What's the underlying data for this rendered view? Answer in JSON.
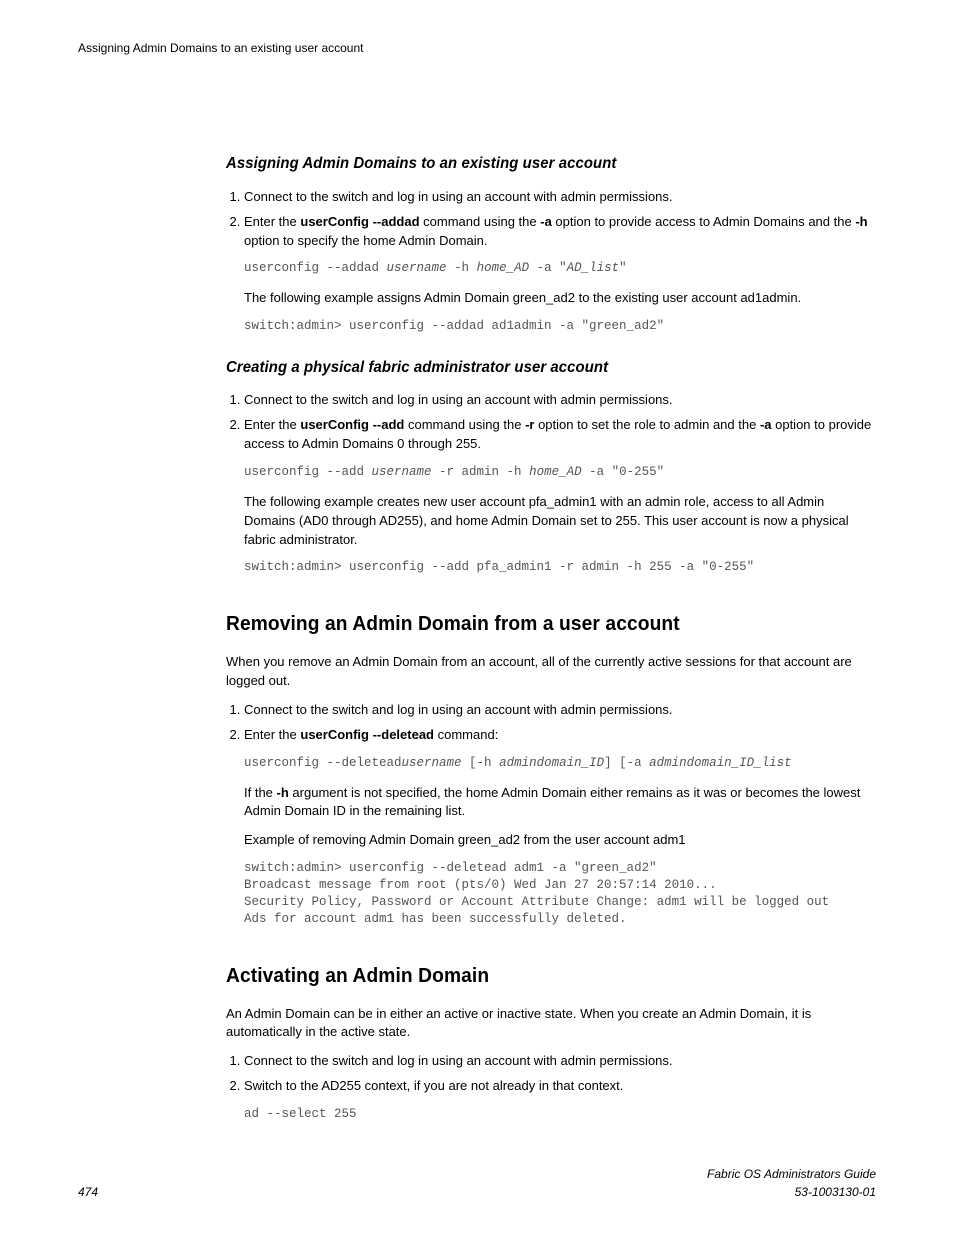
{
  "header": {
    "running": "Assigning Admin Domains to an existing user account"
  },
  "section1": {
    "title": "Assigning Admin Domains to an existing user account",
    "step1": "Connect to the switch and log in using an account with admin permissions.",
    "step2_a": "Enter the ",
    "step2_cmd": "userConfig --addad",
    "step2_b": " command using the ",
    "step2_opt1": "-a",
    "step2_c": " option to provide access to Admin Domains and the ",
    "step2_opt2": "-h",
    "step2_d": " option to specify the home Admin Domain.",
    "code1_a": "userconfig --addad ",
    "code1_b": "username",
    "code1_c": " -h ",
    "code1_d": "home_AD",
    "code1_e": " -a \"",
    "code1_f": "AD_list",
    "code1_g": "\"",
    "note": "The following example assigns Admin Domain green_ad2 to the existing user account ad1admin.",
    "code2": "switch:admin> userconfig --addad ad1admin -a \"green_ad2\""
  },
  "section2": {
    "title": "Creating a physical fabric administrator user account",
    "step1": "Connect to the switch and log in using an account with admin permissions.",
    "step2_a": "Enter the ",
    "step2_cmd": "userConfig --add",
    "step2_b": " command using the ",
    "step2_opt1": "-r",
    "step2_c": " option to set the role to admin and the ",
    "step2_opt2": "-a",
    "step2_d": " option to provide access to Admin Domains 0 through 255.",
    "code1_a": "userconfig --add ",
    "code1_b": "username",
    "code1_c": " -r admin -h ",
    "code1_d": "home_AD",
    "code1_e": " -a \"0-255\"",
    "note": "The following example creates new user account pfa_admin1 with an admin role, access to all Admin Domains (AD0 through AD255), and home Admin Domain set to 255. This user account is now a physical fabric administrator.",
    "code2": "switch:admin> userconfig --add pfa_admin1 -r admin -h 255 -a \"0-255\""
  },
  "section3": {
    "title": "Removing an Admin Domain from a user account",
    "intro": "When you remove an Admin Domain from an account, all of the currently active sessions for that account are logged out.",
    "step1": "Connect to the switch and log in using an account with admin permissions.",
    "step2_a": "Enter the ",
    "step2_cmd": "userConfig --deletead",
    "step2_b": " command:",
    "code1_a": "userconfig --deletead",
    "code1_b": "username",
    "code1_c": " [-h ",
    "code1_d": "admindomain_ID",
    "code1_e": "] [-a ",
    "code1_f": "admindomain_ID_list",
    "note1_a": "If the ",
    "note1_opt": "-h",
    "note1_b": " argument is not specified, the home Admin Domain either remains as it was or becomes the lowest Admin Domain ID in the remaining list.",
    "note2": "Example of removing Admin Domain green_ad2 from the user account adm1",
    "code2": "switch:admin> userconfig --deletead adm1 -a \"green_ad2\"\nBroadcast message from root (pts/0) Wed Jan 27 20:57:14 2010...\nSecurity Policy, Password or Account Attribute Change: adm1 will be logged out\nAds for account adm1 has been successfully deleted."
  },
  "section4": {
    "title": "Activating an Admin Domain",
    "intro": "An Admin Domain can be in either an active or inactive state. When you create an Admin Domain, it is automatically in the active state.",
    "step1": "Connect to the switch and log in using an account with admin permissions.",
    "step2": "Switch to the AD255 context, if you are not already in that context.",
    "code1": "ad --select 255"
  },
  "footer": {
    "page": "474",
    "title": "Fabric OS Administrators Guide",
    "docnum": "53-1003130-01"
  }
}
